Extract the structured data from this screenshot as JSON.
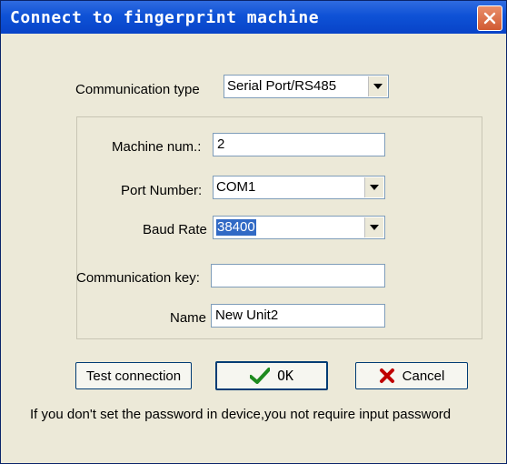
{
  "window": {
    "title": "Connect to fingerprint machine"
  },
  "form": {
    "communication_type": {
      "label": "Communication type",
      "value": "Serial Port/RS485"
    },
    "machine_num": {
      "label": "Machine num.:",
      "value": "2"
    },
    "port_number": {
      "label": "Port Number:",
      "value": "COM1"
    },
    "baud_rate": {
      "label": "Baud Rate",
      "value": "38400"
    },
    "communication_key": {
      "label": "Communication key:",
      "value": ""
    },
    "name": {
      "label": "Name",
      "value": "New Unit2"
    }
  },
  "buttons": {
    "test_connection": "Test connection",
    "ok": "OK",
    "cancel": "Cancel"
  },
  "footer": {
    "note": "If you don't set the password in device,you not require input password"
  },
  "icons": {
    "close": "close-icon",
    "ok": "checkmark-icon",
    "cancel": "x-icon",
    "dropdown": "dropdown-arrow-icon"
  },
  "colors": {
    "titlebar": "#0e52d6",
    "selection": "#316ac5",
    "close_button": "#d15a32",
    "ok_check": "#1e8a1e",
    "cancel_x": "#c00000"
  }
}
